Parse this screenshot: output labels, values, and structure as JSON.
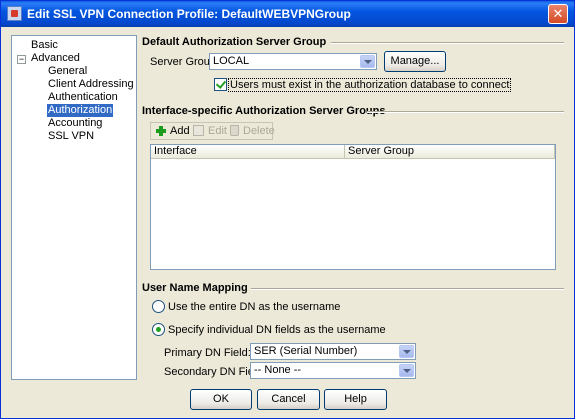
{
  "window": {
    "title": "Edit SSL VPN Connection Profile: DefaultWEBVPNGroup",
    "close_glyph": "✕"
  },
  "tree": {
    "expander": "−",
    "items": [
      "Basic",
      "Advanced",
      "General",
      "Client Addressing",
      "Authentication",
      "Authorization",
      "Accounting",
      "SSL VPN"
    ],
    "selected": "Authorization"
  },
  "default_group": {
    "title": "Default Authorization Server Group",
    "server_group_label": "Server Group:",
    "server_group_value": "LOCAL",
    "manage_label": "Manage...",
    "must_exist_label": "Users must exist in the authorization database to connect",
    "must_exist_checked": true
  },
  "interface_groups": {
    "title": "Interface-specific Authorization Server Groups",
    "toolbar": {
      "add": "Add",
      "edit": "Edit",
      "delete": "Delete"
    },
    "columns": [
      "Interface",
      "Server Group"
    ],
    "rows": []
  },
  "user_name_mapping": {
    "title": "User Name Mapping",
    "option_entire_dn": "Use the entire DN as the username",
    "option_individual": "Specify individual DN fields as the username",
    "selected_option": "individual",
    "primary_label": "Primary DN Field:",
    "primary_value": "SER (Serial Number)",
    "secondary_label": "Secondary DN Field:",
    "secondary_value": "-- None --"
  },
  "buttons": {
    "ok": "OK",
    "cancel": "Cancel",
    "help": "Help"
  }
}
